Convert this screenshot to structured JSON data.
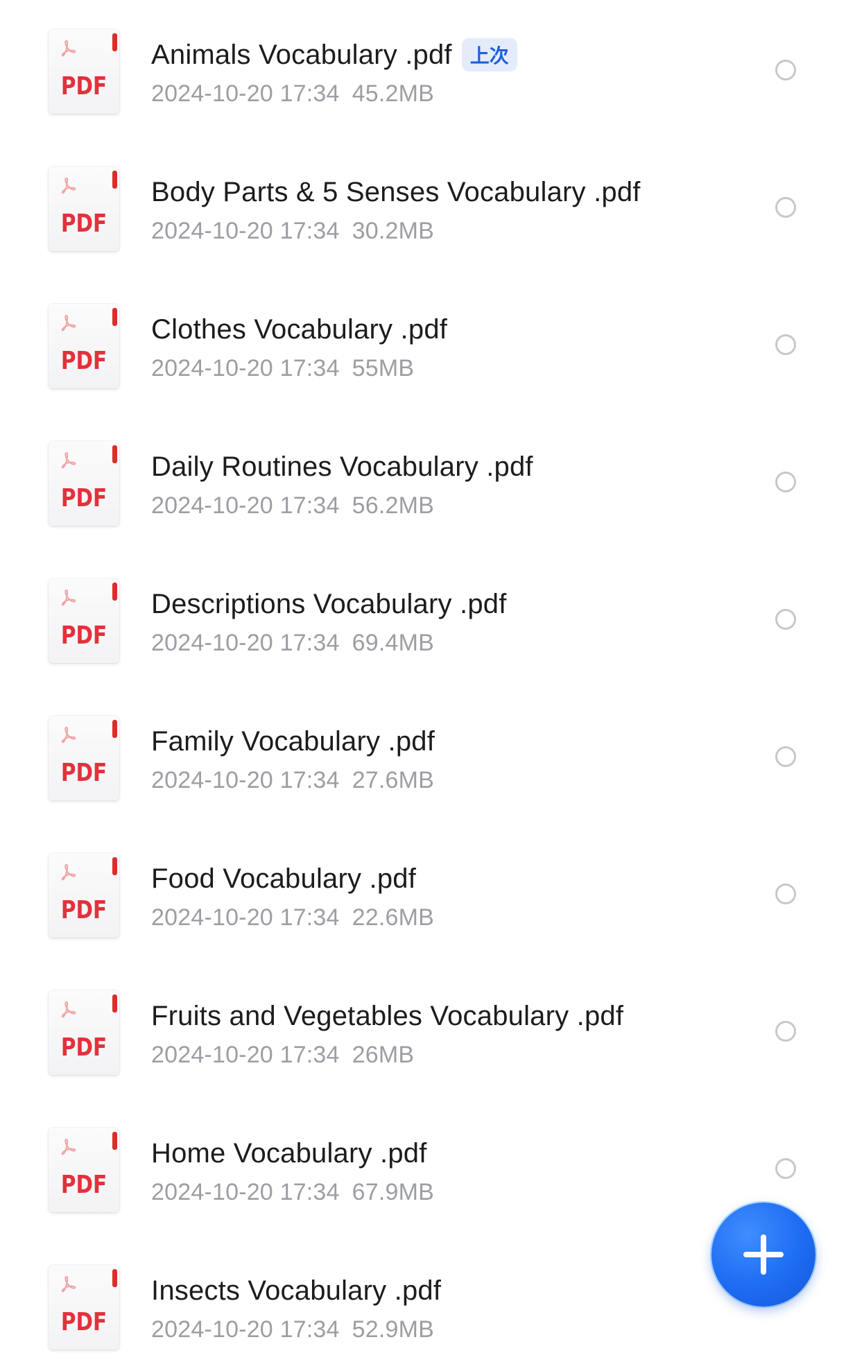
{
  "file_list": {
    "items": [
      {
        "name": "Animals Vocabulary .pdf",
        "badge": "上次",
        "date": "2024-10-20 17:34",
        "size": "45.2MB",
        "type": "PDF"
      },
      {
        "name": "Body Parts & 5 Senses Vocabulary .pdf",
        "date": "2024-10-20 17:34",
        "size": "30.2MB",
        "type": "PDF"
      },
      {
        "name": "Clothes Vocabulary .pdf",
        "date": "2024-10-20 17:34",
        "size": "55MB",
        "type": "PDF"
      },
      {
        "name": "Daily Routines Vocabulary .pdf",
        "date": "2024-10-20 17:34",
        "size": "56.2MB",
        "type": "PDF"
      },
      {
        "name": "Descriptions Vocabulary .pdf",
        "date": "2024-10-20 17:34",
        "size": "69.4MB",
        "type": "PDF"
      },
      {
        "name": "Family Vocabulary .pdf",
        "date": "2024-10-20 17:34",
        "size": "27.6MB",
        "type": "PDF"
      },
      {
        "name": "Food Vocabulary .pdf",
        "date": "2024-10-20 17:34",
        "size": "22.6MB",
        "type": "PDF"
      },
      {
        "name": "Fruits and Vegetables Vocabulary .pdf",
        "date": "2024-10-20 17:34",
        "size": "26MB",
        "type": "PDF"
      },
      {
        "name": "Home Vocabulary .pdf",
        "date": "2024-10-20 17:34",
        "size": "67.9MB",
        "type": "PDF"
      },
      {
        "name": "Insects Vocabulary .pdf",
        "date": "2024-10-20 17:34",
        "size": "52.9MB",
        "type": "PDF"
      }
    ]
  },
  "fab": {
    "icon": "plus-icon"
  },
  "colors": {
    "pdf_red": "#e3313b",
    "badge_bg": "#e4ecfb",
    "badge_text": "#1f5fe0",
    "fab_blue": "#1d6cf2",
    "meta_gray": "#9c9ea3"
  }
}
